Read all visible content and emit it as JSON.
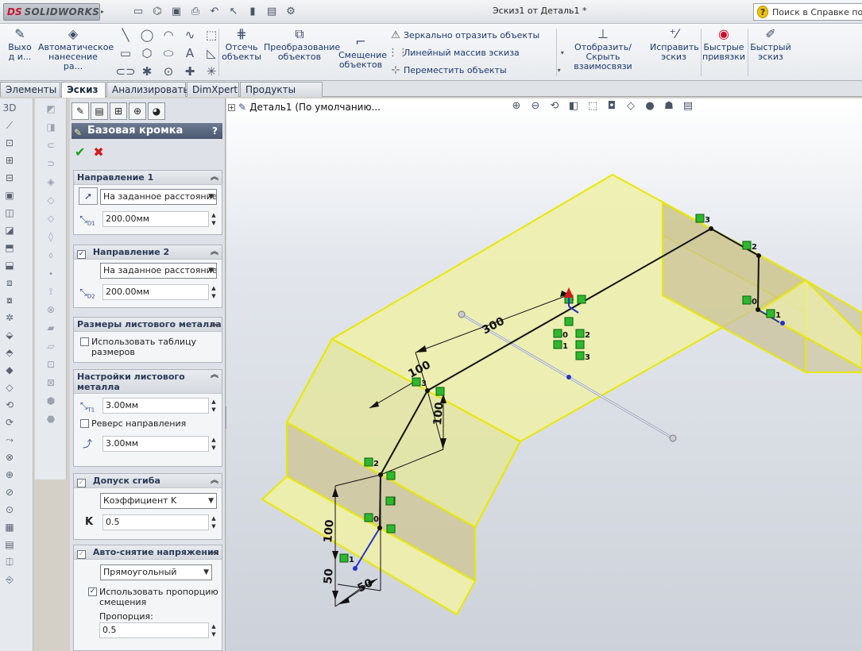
{
  "app": {
    "logo_ds": "DS",
    "logo_name": "SOLIDWORKS",
    "window_title": "Эскиз1 от Деталь1 *",
    "help_search": "Поиск в Справке по So"
  },
  "ribbon": {
    "exit_label": "Выхо д и...",
    "smart_dim_label": "Автоматическое нанесение ра...",
    "trim_label": "Отсечь объекты",
    "convert_label": "Преобразование объектов",
    "offset_label": "Смещение объектов",
    "mirror_label": "Зеркально отразить объекты",
    "linear_pattern_label": "Линейный массив эскиза",
    "move_label": "Переместить объекты",
    "display_relations_label": "Отобразить/Скрыть взаимосвязи",
    "repair_label": "Исправить эскиз",
    "quick_snaps_label": "Быстрые привязки",
    "rapid_sketch_label": "Быстрый эскиз"
  },
  "tabs": [
    {
      "label": "Элементы"
    },
    {
      "label": "Эскиз"
    },
    {
      "label": "Анализировать"
    },
    {
      "label": "DimXpert"
    },
    {
      "label": "Продукты Office"
    }
  ],
  "tree": {
    "root": "Деталь1  (По умолчанию..."
  },
  "pm": {
    "title": "Базовая кромка",
    "help": "?",
    "dir1": {
      "header": "Направление 1",
      "end_condition": "На заданное расстояние",
      "distance": "200.00мм",
      "icon_label": "D1"
    },
    "dir2": {
      "header": "Направление 2",
      "end_condition": "На заданное расстояние",
      "distance": "200.00мм",
      "icon_label": "D2",
      "enabled": true
    },
    "gauge": {
      "header": "Размеры листового металла",
      "use_table": "Использовать таблицу размеров"
    },
    "params": {
      "header": "Настройки листового металла",
      "thickness": "3.00мм",
      "thickness_icon": "T1",
      "reverse": "Реверс направления",
      "radius": "3.00мм"
    },
    "bend": {
      "header": "Допуск сгиба",
      "type": "Коэффициент K",
      "k_label": "K",
      "k_value": "0.5"
    },
    "relief": {
      "header": "Авто-снятие напряжения",
      "type": "Прямоугольный",
      "use_ratio": "Использовать пропорцию смещения",
      "ratio_label": "Пропорция:",
      "ratio_value": "0.5"
    }
  },
  "dims": {
    "d300": "300",
    "d100_top": "100",
    "d100_side": "100",
    "d100_left": "100",
    "d50_left": "50",
    "d50_bottom": "50"
  },
  "relations": {
    "r0": "0",
    "r1": "1",
    "r2": "2",
    "r3": "3"
  }
}
